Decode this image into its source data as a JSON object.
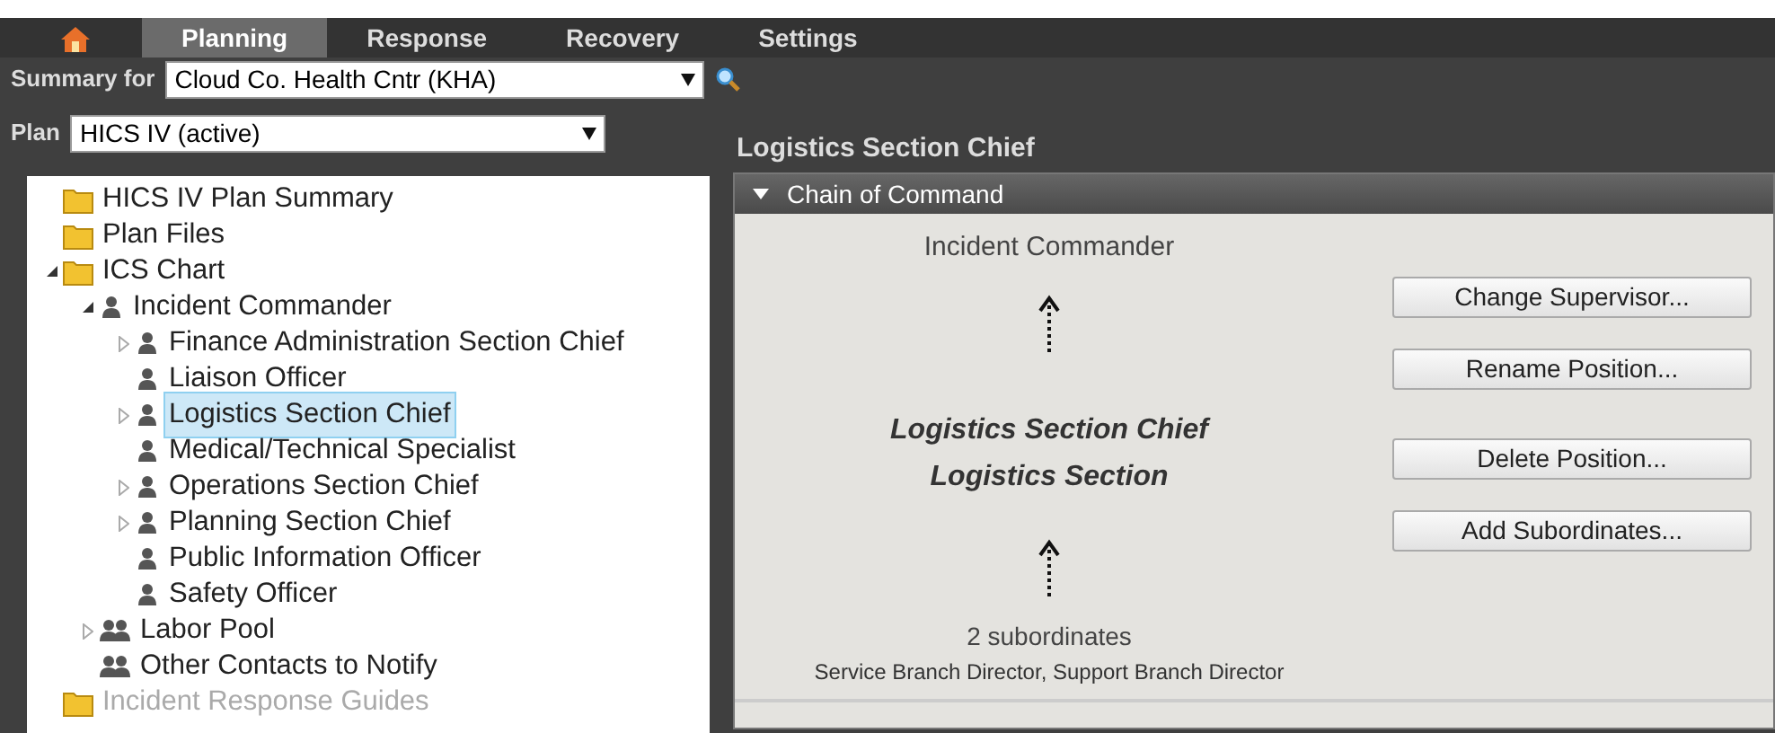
{
  "tabs": [
    {
      "kind": "home",
      "selected": false
    },
    {
      "label": "Planning",
      "selected": true
    },
    {
      "label": "Response",
      "selected": false
    },
    {
      "label": "Recovery",
      "selected": false
    },
    {
      "label": "Settings",
      "selected": false
    }
  ],
  "summary": {
    "label": "Summary for",
    "value": "Cloud Co. Health Cntr (KHA)"
  },
  "plan": {
    "label": "Plan",
    "value": "HICS IV (active)"
  },
  "tree": [
    {
      "label": "HICS IV Plan Summary",
      "kind": "folder",
      "selected": false
    },
    {
      "label": "Plan Files",
      "kind": "folder",
      "selected": false
    },
    {
      "label": "ICS Chart",
      "kind": "folder",
      "selected": false,
      "expanded": true,
      "children": [
        {
          "label": "Incident Commander",
          "kind": "person",
          "selected": false,
          "expanded": true,
          "children": [
            {
              "label": "Finance Administration Section Chief",
              "kind": "person",
              "selected": false,
              "expanded": false
            },
            {
              "label": "Liaison Officer",
              "kind": "person",
              "selected": false
            },
            {
              "label": "Logistics Section Chief",
              "kind": "person",
              "selected": true,
              "expanded": false
            },
            {
              "label": "Medical/Technical Specialist",
              "kind": "person",
              "selected": false
            },
            {
              "label": "Operations Section Chief",
              "kind": "person",
              "selected": false,
              "expanded": false
            },
            {
              "label": "Planning Section Chief",
              "kind": "person",
              "selected": false,
              "expanded": false
            },
            {
              "label": "Public Information Officer",
              "kind": "person",
              "selected": false
            },
            {
              "label": "Safety Officer",
              "kind": "person",
              "selected": false
            }
          ]
        },
        {
          "label": "Labor Pool",
          "kind": "group",
          "selected": false,
          "expanded": false
        },
        {
          "label": "Other Contacts to Notify",
          "kind": "group",
          "selected": false
        }
      ]
    },
    {
      "label": "Incident Response Guides",
      "kind": "folder",
      "selected": false,
      "disabled": true
    }
  ],
  "detail": {
    "title": "Logistics Section Chief",
    "section": {
      "title": "Chain of Command",
      "expanded": true
    },
    "supervisor": "Incident Commander",
    "position": "Logistics Section Chief",
    "section_name": "Logistics Section",
    "subordinate_count": "2 subordinates",
    "subordinates": "Service Branch Director, Support Branch Director",
    "buttons": [
      "Change Supervisor...",
      "Rename Position...",
      "Delete Position...",
      "Add Subordinates..."
    ]
  }
}
